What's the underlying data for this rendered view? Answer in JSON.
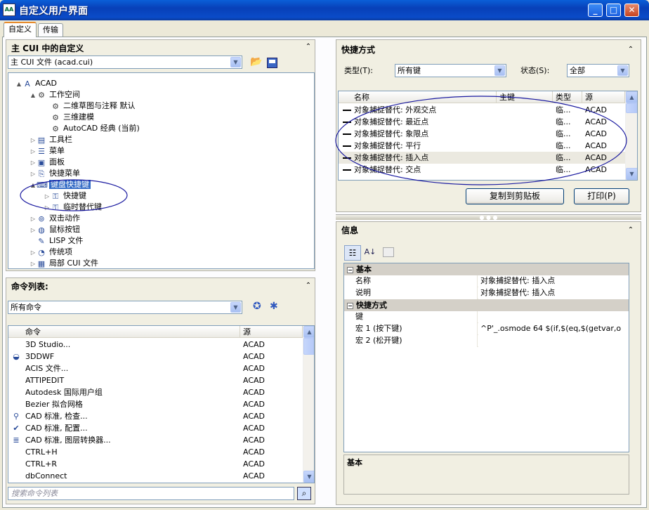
{
  "window": {
    "title": "自定义用户界面",
    "icon_text": "AA"
  },
  "tabs": [
    {
      "label": "自定义"
    },
    {
      "label": "传输"
    }
  ],
  "cui_panel": {
    "title": "主 CUI 中的自定义",
    "file_combo": "主 CUI 文件 (acad.cui)",
    "tree": [
      {
        "label": "ACAD",
        "icon": "acad-icon",
        "level": 0,
        "toggle": "▲"
      },
      {
        "label": "工作空间",
        "icon": "gear-icon",
        "level": 1,
        "toggle": "▲"
      },
      {
        "label": "二维草图与注释 默认",
        "icon": "gear-icon",
        "level": 2,
        "toggle": ""
      },
      {
        "label": "三维建模",
        "icon": "gear-icon",
        "level": 2,
        "toggle": ""
      },
      {
        "label": "AutoCAD 经典 (当前)",
        "icon": "gear-icon",
        "level": 2,
        "toggle": ""
      },
      {
        "label": "工具栏",
        "icon": "toolbar-icon",
        "level": 1,
        "toggle": "▷"
      },
      {
        "label": "菜单",
        "icon": "menu-icon",
        "level": 1,
        "toggle": "▷"
      },
      {
        "label": "面板",
        "icon": "panel-icon",
        "level": 1,
        "toggle": "▷"
      },
      {
        "label": "快捷菜单",
        "icon": "shortcut-menu-icon",
        "level": 1,
        "toggle": "▷"
      },
      {
        "label": "键盘快捷键",
        "icon": "keyboard-icon",
        "level": 1,
        "toggle": "▲",
        "selected": true
      },
      {
        "label": "快捷键",
        "icon": "key-icon",
        "level": 2,
        "toggle": "▷"
      },
      {
        "label": "临时替代键",
        "icon": "key-icon",
        "level": 2,
        "toggle": "▷"
      },
      {
        "label": "双击动作",
        "icon": "mouse-action-icon",
        "level": 1,
        "toggle": "▷"
      },
      {
        "label": "鼠标按钮",
        "icon": "mouse-icon",
        "level": 1,
        "toggle": "▷"
      },
      {
        "label": "LISP 文件",
        "icon": "lisp-icon",
        "level": 1,
        "toggle": ""
      },
      {
        "label": "传统项",
        "icon": "legacy-icon",
        "level": 1,
        "toggle": "▷"
      },
      {
        "label": "局部 CUI 文件",
        "icon": "file-icon",
        "level": 1,
        "toggle": "▷"
      }
    ]
  },
  "command_panel": {
    "title": "命令列表:",
    "filter_combo": "所有命令",
    "columns": [
      "命令",
      "源"
    ],
    "rows": [
      {
        "name": "3D Studio...",
        "source": "ACAD",
        "icon": ""
      },
      {
        "name": "3DDWF",
        "source": "ACAD",
        "icon": "3ddwf-icon"
      },
      {
        "name": "ACIS 文件...",
        "source": "ACAD",
        "icon": ""
      },
      {
        "name": "ATTIPEDIT",
        "source": "ACAD",
        "icon": ""
      },
      {
        "name": "Autodesk 国际用户组",
        "source": "ACAD",
        "icon": ""
      },
      {
        "name": "Bezier 拟合网格",
        "source": "ACAD",
        "icon": ""
      },
      {
        "name": "CAD 标准, 检查...",
        "source": "ACAD",
        "icon": "check-icon"
      },
      {
        "name": "CAD 标准, 配置...",
        "source": "ACAD",
        "icon": "configure-icon"
      },
      {
        "name": "CAD 标准, 图层转换器...",
        "source": "ACAD",
        "icon": "layer-icon"
      },
      {
        "name": "CTRL+H",
        "source": "ACAD",
        "icon": ""
      },
      {
        "name": "CTRL+R",
        "source": "ACAD",
        "icon": ""
      },
      {
        "name": "dbConnect",
        "source": "ACAD",
        "icon": ""
      }
    ],
    "search_placeholder": "搜索命令列表"
  },
  "shortcut_panel": {
    "title": "快捷方式",
    "type_label": "类型(T):",
    "type_value": "所有键",
    "status_label": "状态(S):",
    "status_value": "全部",
    "columns": [
      "名称",
      "主键",
      "类型",
      "源"
    ],
    "rows": [
      {
        "name": "对象捕捉替代: 外观交点",
        "key": "",
        "type": "临...",
        "source": "ACAD"
      },
      {
        "name": "对象捕捉替代: 最近点",
        "key": "",
        "type": "临...",
        "source": "ACAD"
      },
      {
        "name": "对象捕捉替代: 象限点",
        "key": "",
        "type": "临...",
        "source": "ACAD"
      },
      {
        "name": "对象捕捉替代: 平行",
        "key": "",
        "type": "临...",
        "source": "ACAD"
      },
      {
        "name": "对象捕捉替代: 插入点",
        "key": "",
        "type": "临...",
        "source": "ACAD",
        "selected": true
      },
      {
        "name": "对象捕捉替代: 交点",
        "key": "",
        "type": "临...",
        "source": "ACAD"
      }
    ],
    "copy_button": "复制到剪贴板",
    "print_button": "打印(P)"
  },
  "info_panel": {
    "title": "信息",
    "cat_basic": "基本",
    "props_basic": [
      {
        "k": "名称",
        "v": "对象捕捉替代: 插入点"
      },
      {
        "k": "说明",
        "v": "对象捕捉替代: 插入点"
      }
    ],
    "cat_shortcut": "快捷方式",
    "props_shortcut": [
      {
        "k": "键",
        "v": ""
      },
      {
        "k": "宏 1 (按下键)",
        "v": "^P'_.osmode 64 $(if,$(eq,$(getvar,o"
      },
      {
        "k": "宏 2 (松开键)",
        "v": ""
      }
    ],
    "desc_title": "基本"
  },
  "colors": {
    "title_bar": "#0a4bc8",
    "accent": "#e68b2c",
    "selection": "#316ac5",
    "annotation": "#1a1aa0"
  }
}
